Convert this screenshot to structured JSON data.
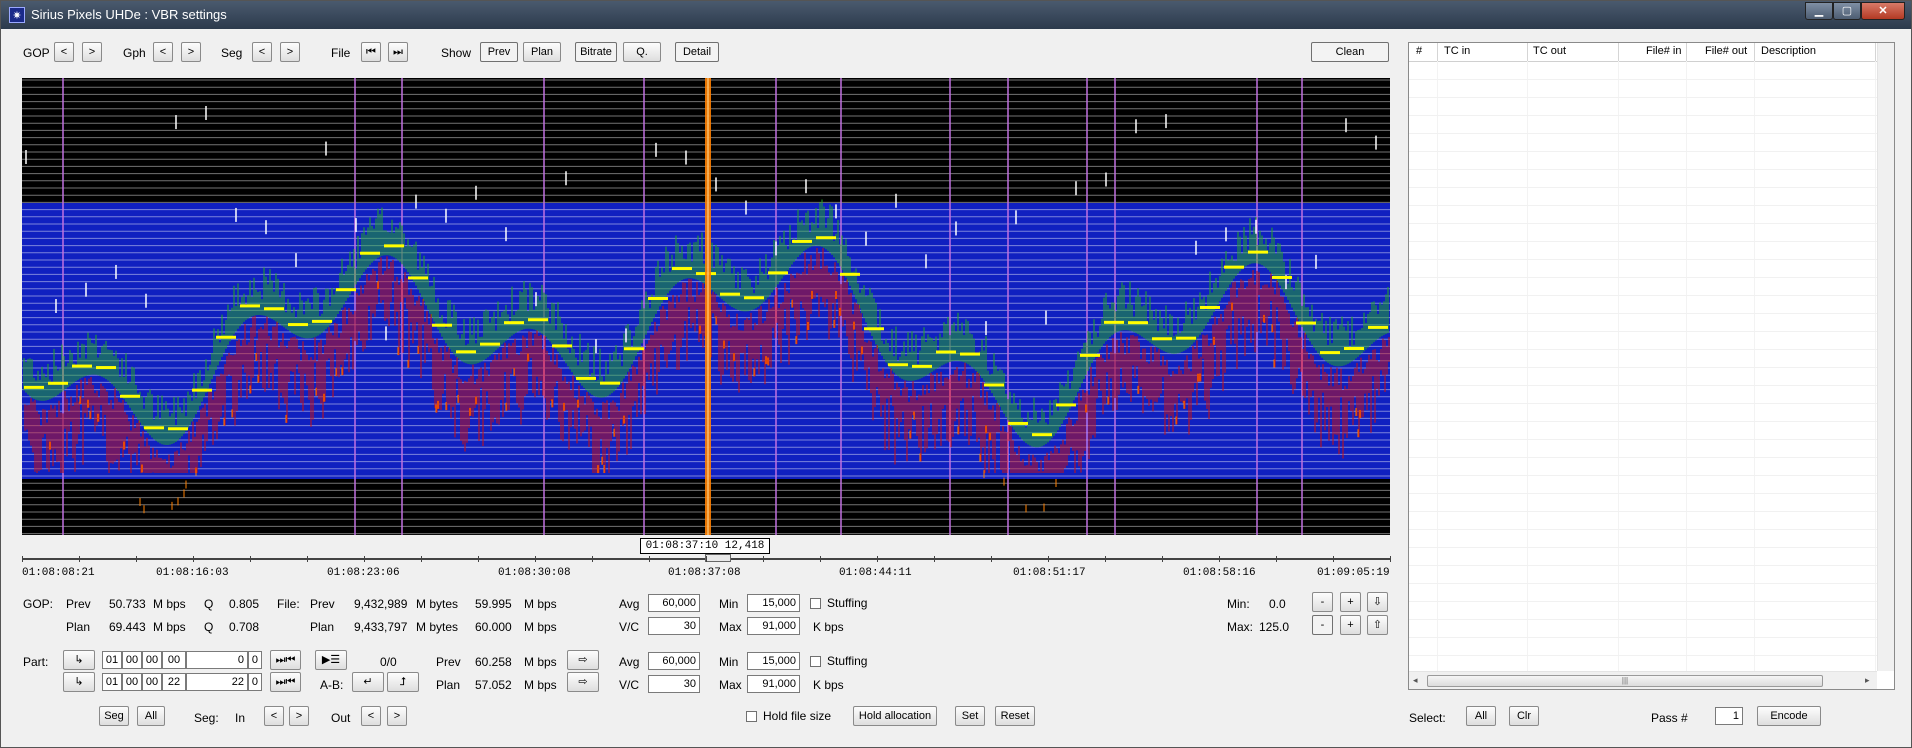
{
  "window": {
    "title": "Sirius Pixels UHDe : VBR settings"
  },
  "toolbar": {
    "gop_label": "GOP",
    "gph_label": "Gph",
    "seg_label": "Seg",
    "file_label": "File",
    "show_label": "Show",
    "prev_sym": "<",
    "next_sym": ">",
    "first_sym": "⏮",
    "last_sym": "⏭",
    "prev_btn": "Prev",
    "plan_btn": "Plan",
    "bitrate_btn": "Bitrate",
    "q_btn": "Q.",
    "detail_btn": "Detail",
    "clean_btn": "Clean"
  },
  "timeline": {
    "labels": [
      "01:08:08:21",
      "01:08:16:03",
      "01:08:23:06",
      "01:08:30:08",
      "01:08:37:08",
      "01:08:44:11",
      "01:08:51:17",
      "01:08:58:16",
      "01:09:05:19"
    ],
    "cursor_readout": "01:08:37:10 12,418"
  },
  "stats": {
    "gop_label": "GOP:",
    "prev_label": "Prev",
    "plan_label": "Plan",
    "gop_prev_rate": "50.733",
    "gop_plan_rate": "69.443",
    "mbps": "M bps",
    "q_label": "Q",
    "gop_prev_q": "0.805",
    "gop_plan_q": "0.708",
    "file_label": "File:",
    "file_prev_bytes": "9,432,989",
    "file_plan_bytes": "9,433,797",
    "mbytes": "M bytes",
    "file_prev_rate": "59.995",
    "file_plan_rate": "60.000",
    "avg_label": "Avg",
    "vc_label": "V/C",
    "min_label": "Min",
    "max_label": "Max",
    "kbps": "K bps",
    "file_avg": "60,000",
    "file_vc": "30",
    "file_min": "15,000",
    "file_max": "91,000",
    "stuffing_label": "Stuffing",
    "scale_min_label": "Min:",
    "scale_max_label": "Max:",
    "scale_min": "0.0",
    "scale_max": "125.0",
    "minus_sym": "-",
    "plus_sym": "+",
    "down_sym": "⇩",
    "up_sym": "⇧"
  },
  "part": {
    "label": "Part:",
    "tc_in": [
      "01",
      "00",
      "00",
      "00"
    ],
    "frame_in": "0",
    "sub_in": "0",
    "tc_out": [
      "01",
      "00",
      "00",
      "22"
    ],
    "frame_out": "22",
    "sub_out": "0",
    "goto_sym": "⏭⏮",
    "arrow_in": "↳",
    "ab_label": "A-B:",
    "count": "0/0",
    "prev_label": "Prev",
    "plan_label": "Plan",
    "prev_rate": "60.258",
    "plan_rate": "57.052",
    "mbps": "M bps",
    "avg": "60,000",
    "vc": "30",
    "min": "15,000",
    "max": "91,000",
    "apply_sym": "⇨",
    "list_sym": "▶☰",
    "ret_sym": "↵",
    "ret2_sym": "⮥"
  },
  "bottom": {
    "seg_btn": "Seg",
    "all_btn": "All",
    "seg_label": "Seg:",
    "in_label": "In",
    "out_label": "Out",
    "hold_file_size": "Hold file size",
    "hold_allocation": "Hold allocation",
    "set": "Set",
    "reset": "Reset",
    "select_label": "Select:",
    "select_all": "All",
    "select_clr": "Clr",
    "pass_label": "Pass #",
    "pass_value": "1",
    "encode": "Encode"
  },
  "list": {
    "columns": [
      "#",
      "TC in",
      "TC out",
      "File# in",
      "File# out",
      "Description"
    ]
  },
  "colors": {
    "graph_bg": "#000000",
    "band": "#1020c0",
    "bitrate_green": "#22aa22",
    "q_red": "#cc1010",
    "plan_yellow": "#ffff00",
    "cursor_orange": "#ff8000",
    "gop_marker": "#c070e0"
  }
}
